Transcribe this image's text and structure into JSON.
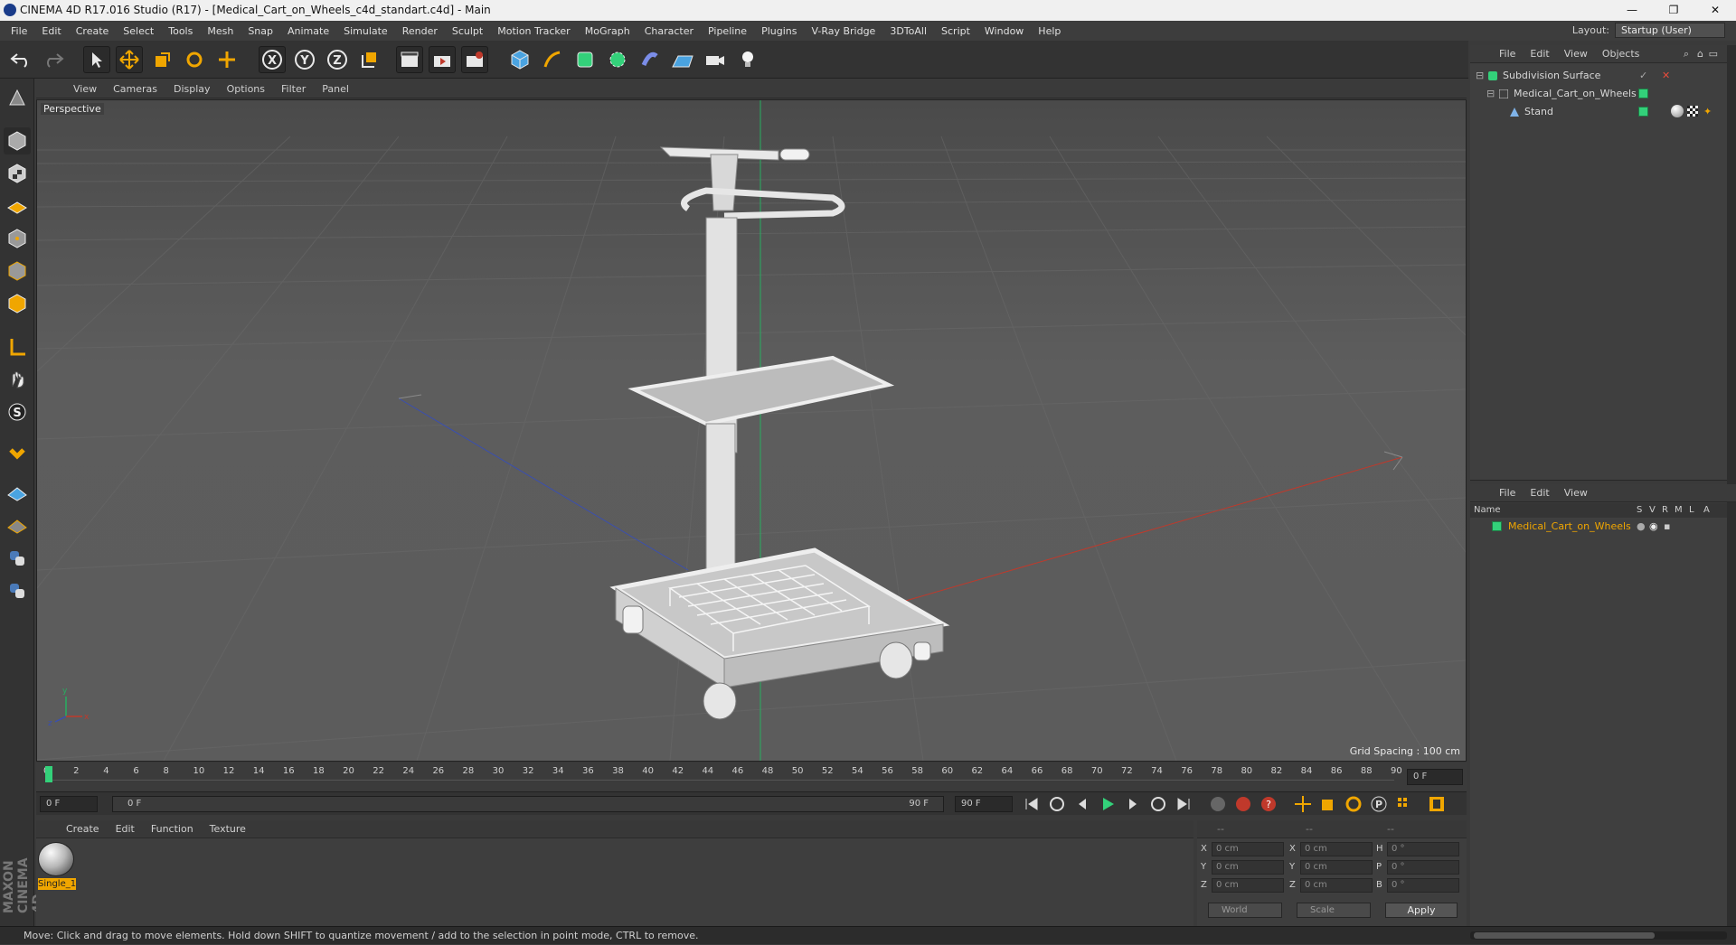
{
  "window": {
    "title": "CINEMA 4D R17.016 Studio (R17) - [Medical_Cart_on_Wheels_c4d_standart.c4d] - Main",
    "minimize": "—",
    "restore": "❐",
    "close": "✕"
  },
  "menubar": {
    "items": [
      "File",
      "Edit",
      "Create",
      "Select",
      "Tools",
      "Mesh",
      "Snap",
      "Animate",
      "Simulate",
      "Render",
      "Sculpt",
      "Motion Tracker",
      "MoGraph",
      "Character",
      "Pipeline",
      "Plugins",
      "V-Ray Bridge",
      "3DToAll",
      "Script",
      "Window",
      "Help"
    ],
    "layout_label": "Layout:",
    "layout_value": "Startup (User)"
  },
  "toolbar": {
    "x_label": "X",
    "y_label": "Y",
    "z_label": "Z"
  },
  "viewport": {
    "menu": [
      "View",
      "Cameras",
      "Display",
      "Options",
      "Filter",
      "Panel"
    ],
    "camera_label": "Perspective",
    "grid_spacing": "Grid Spacing : 100 cm"
  },
  "timeline": {
    "ticks": [
      "0",
      "2",
      "4",
      "6",
      "8",
      "10",
      "12",
      "14",
      "16",
      "18",
      "20",
      "22",
      "24",
      "26",
      "28",
      "30",
      "32",
      "34",
      "36",
      "38",
      "40",
      "42",
      "44",
      "46",
      "48",
      "50",
      "52",
      "54",
      "56",
      "58",
      "60",
      "62",
      "64",
      "66",
      "68",
      "70",
      "72",
      "74",
      "76",
      "78",
      "80",
      "82",
      "84",
      "86",
      "88",
      "90"
    ],
    "end_field": "0 F",
    "current_frame": "0 F",
    "range_start": "0 F",
    "range_end": "90 F",
    "max_frame": "90 F"
  },
  "materials": {
    "menu": [
      "Create",
      "Edit",
      "Function",
      "Texture"
    ],
    "items": [
      {
        "name": "Single_1"
      }
    ]
  },
  "coordinates": {
    "header": [
      "--",
      "--",
      "--"
    ],
    "rows": [
      {
        "l1": "X",
        "v1": "0 cm",
        "l2": "X",
        "v2": "0 cm",
        "l3": "H",
        "v3": "0 °"
      },
      {
        "l1": "Y",
        "v1": "0 cm",
        "l2": "Y",
        "v2": "0 cm",
        "l3": "P",
        "v3": "0 °"
      },
      {
        "l1": "Z",
        "v1": "0 cm",
        "l2": "Z",
        "v2": "0 cm",
        "l3": "B",
        "v3": "0 °"
      }
    ],
    "mode": "World",
    "scale": "Scale",
    "apply": "Apply"
  },
  "objects": {
    "menu": [
      "File",
      "Edit",
      "View",
      "Objects"
    ],
    "tree": [
      {
        "name": "Subdivision Surface",
        "level": 0
      },
      {
        "name": "Medical_Cart_on_Wheels",
        "level": 1
      },
      {
        "name": "Stand",
        "level": 2
      }
    ]
  },
  "layers": {
    "menu": [
      "File",
      "Edit",
      "View"
    ],
    "columns": [
      "Name",
      "S",
      "V",
      "R",
      "M",
      "L",
      "A"
    ],
    "rows": [
      {
        "name": "Medical_Cart_on_Wheels"
      }
    ]
  },
  "status": {
    "text": "Move: Click and drag to move elements. Hold down SHIFT to quantize movement / add to the selection in point mode, CTRL to remove."
  },
  "colors": {
    "accent_orange": "#f0a600",
    "object_green": "#33d17a",
    "axis_x": "#c0392b",
    "axis_y": "#27ae60",
    "axis_z": "#3a4fb0"
  }
}
